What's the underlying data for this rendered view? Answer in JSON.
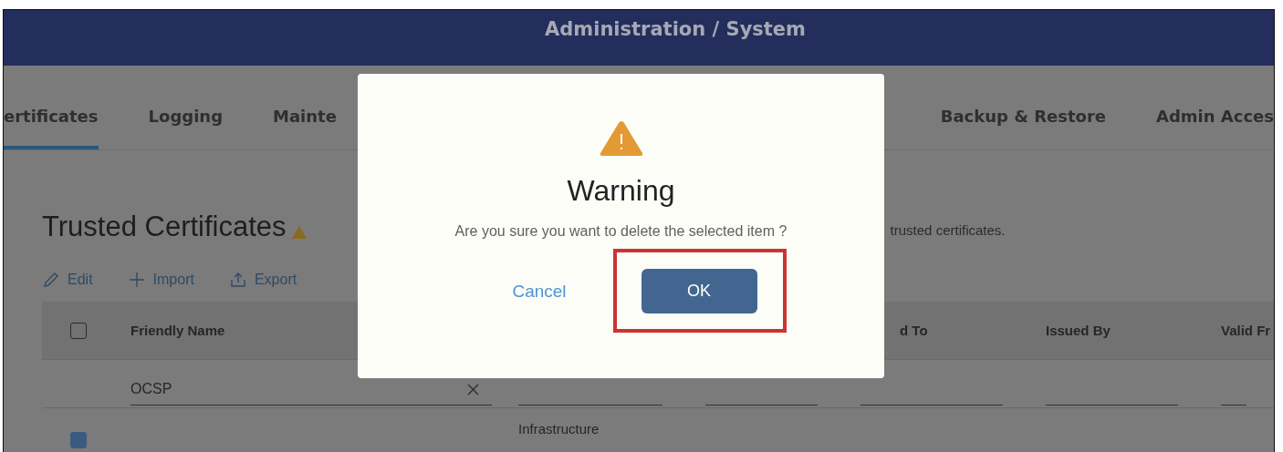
{
  "header": {
    "title": "Administration / System"
  },
  "tabs": [
    {
      "label": "ertificates",
      "selected": true
    },
    {
      "label": "Logging",
      "selected": false
    },
    {
      "label": "Mainte",
      "selected": false
    },
    {
      "label": "Backup & Restore",
      "selected": false
    },
    {
      "label": "Admin Acces",
      "selected": false
    }
  ],
  "page": {
    "title": "Trusted Certificates",
    "note": "trusted certificates."
  },
  "toolbar": [
    {
      "kind": "edit",
      "label": "Edit"
    },
    {
      "kind": "import",
      "label": "Import"
    },
    {
      "kind": "export",
      "label": "Export"
    }
  ],
  "table": {
    "select_all_checked": false,
    "columns": [
      "Friendly Name",
      null,
      null,
      "d To",
      "Issued By",
      "Valid Fr"
    ],
    "name_filter": "OCSP",
    "rows": [
      {
        "selected": true,
        "cells": [
          null,
          "Infrastructure",
          null,
          null,
          null,
          null
        ]
      }
    ]
  },
  "dialog": {
    "title": "Warning",
    "message": "Are you sure you want to delete the selected item ?",
    "cancel": "Cancel",
    "ok": "OK",
    "ok_highlighted": true
  }
}
